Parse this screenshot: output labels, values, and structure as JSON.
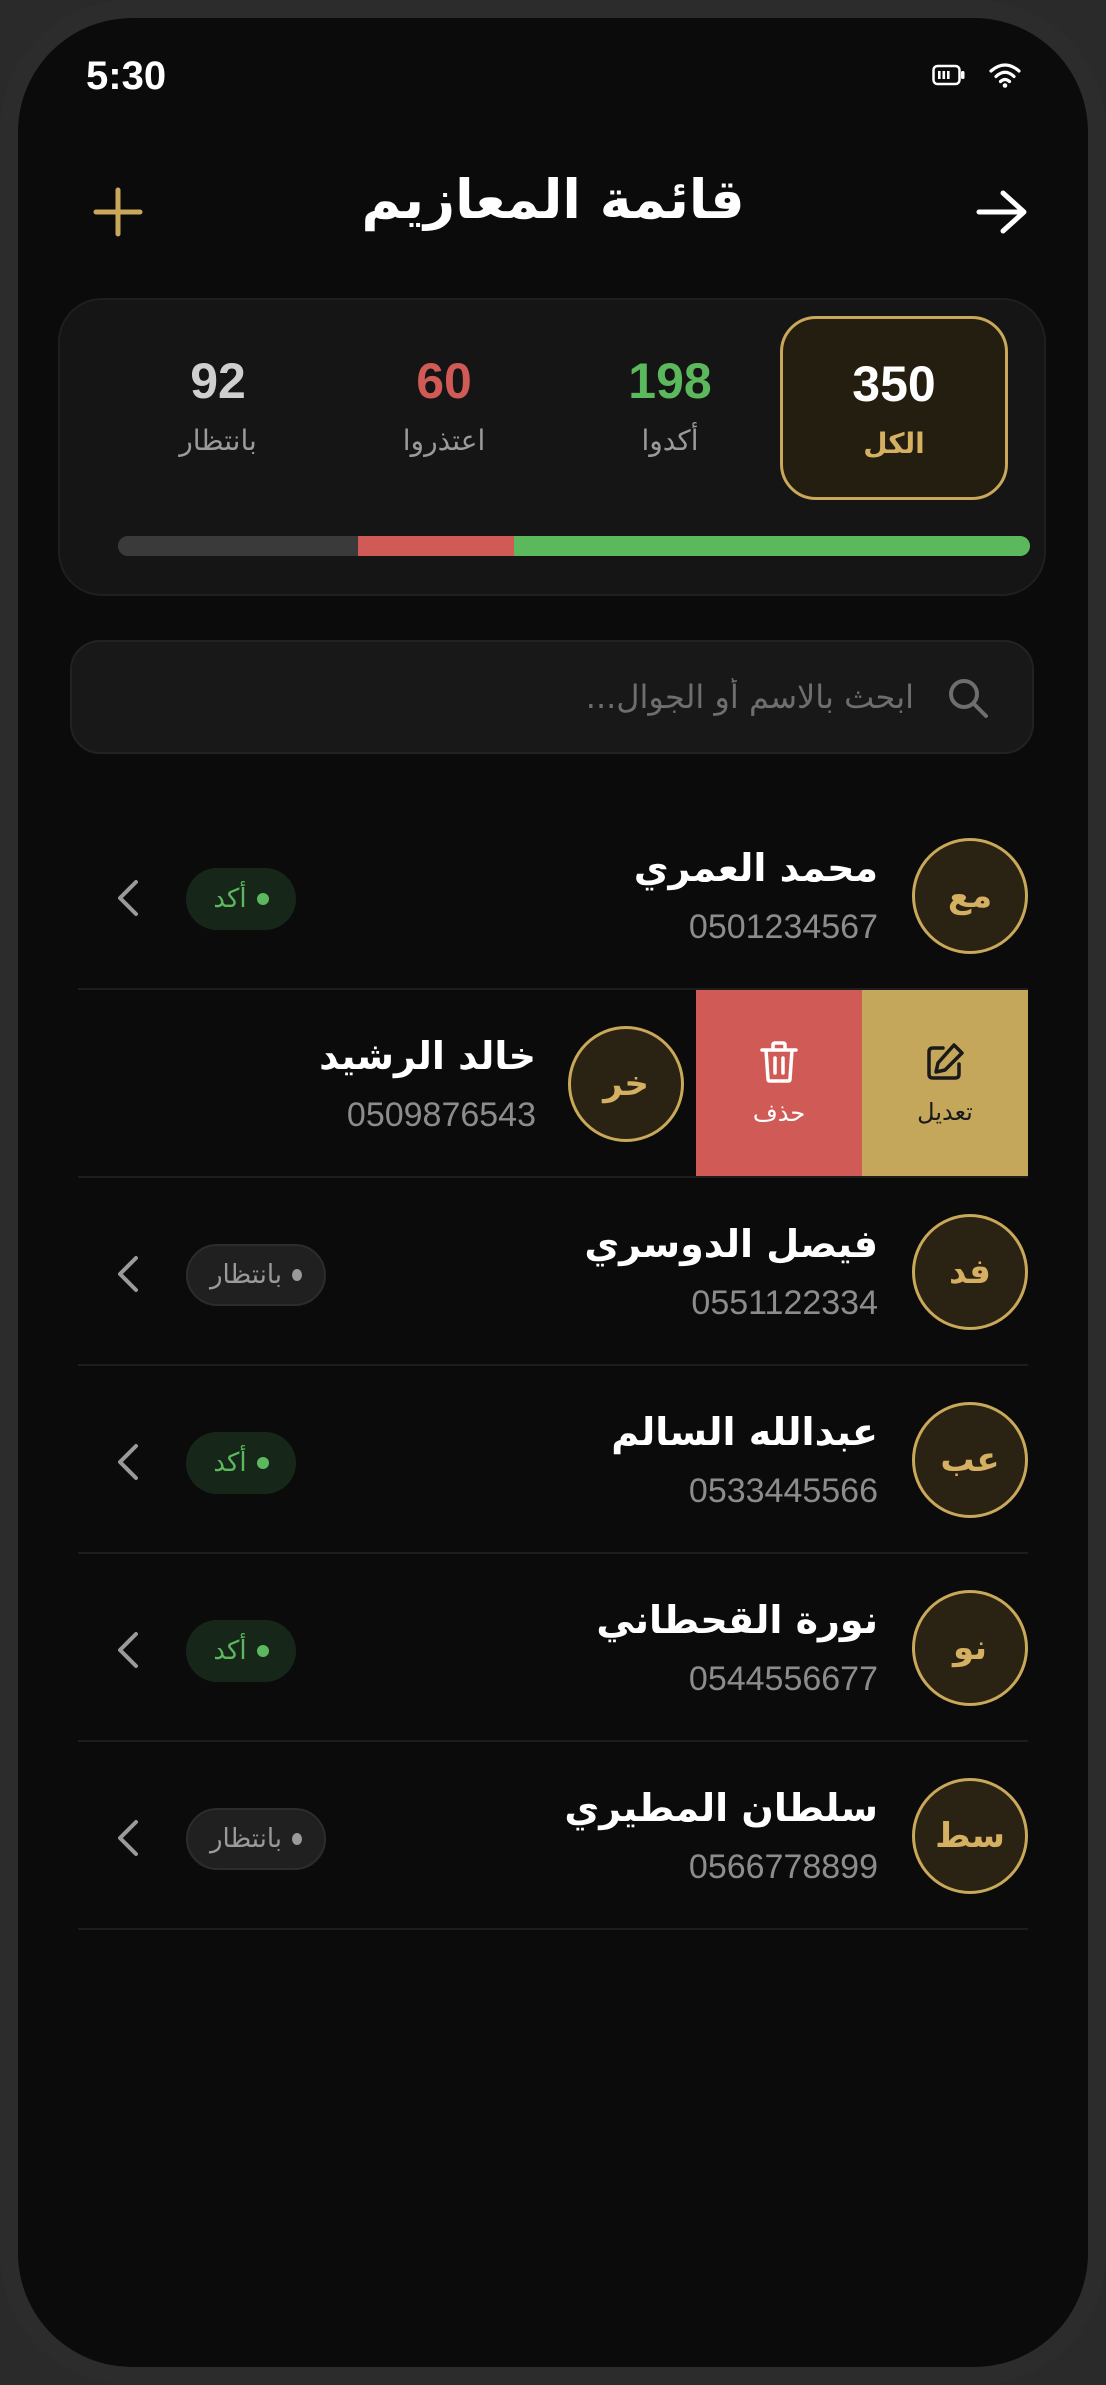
{
  "status": {
    "time": "5:30"
  },
  "header": {
    "title": "قائمة المعازيم"
  },
  "stats": [
    {
      "key": "all",
      "label": "الكل",
      "value": "350",
      "color": "#ffffff",
      "active": true
    },
    {
      "key": "confirmed",
      "label": "أكدوا",
      "value": "198",
      "color": "#5cb85c",
      "active": false
    },
    {
      "key": "declined",
      "label": "اعتذروا",
      "value": "60",
      "color": "#d05a55",
      "active": false
    },
    {
      "key": "pending",
      "label": "بانتظار",
      "value": "92",
      "color": "#cfcfcf",
      "active": false
    }
  ],
  "progress": {
    "total": 350,
    "confirmed": 198,
    "declined": 60,
    "pending": 92
  },
  "colors": {
    "accent": "#c9a85a",
    "confirmed": "#5cb85c",
    "declined": "#d05a55",
    "pending": "#3a3a3a"
  },
  "search": {
    "placeholder": "ابحث بالاسم أو الجوال..."
  },
  "guests": [
    {
      "initials": "مع",
      "name": "محمد العمري",
      "phone": "0501234567",
      "status": "أكد",
      "status_type": "ok"
    },
    {
      "initials": "خر",
      "name": "خالد الرشيد",
      "phone": "0509876543",
      "swiped": true
    },
    {
      "initials": "فد",
      "name": "فيصل الدوسري",
      "phone": "0551122334",
      "status": "بانتظار",
      "status_type": "pending"
    },
    {
      "initials": "عب",
      "name": "عبدالله السالم",
      "phone": "0533445566",
      "status": "أكد",
      "status_type": "ok"
    },
    {
      "initials": "نو",
      "name": "نورة القحطاني",
      "phone": "0544556677",
      "status": "أكد",
      "status_type": "ok"
    },
    {
      "initials": "سط",
      "name": "سلطان المطيري",
      "phone": "0566778899",
      "status": "بانتظار",
      "status_type": "pending"
    }
  ],
  "swipe_actions": {
    "edit_label": "تعديل",
    "delete_label": "حذف"
  }
}
